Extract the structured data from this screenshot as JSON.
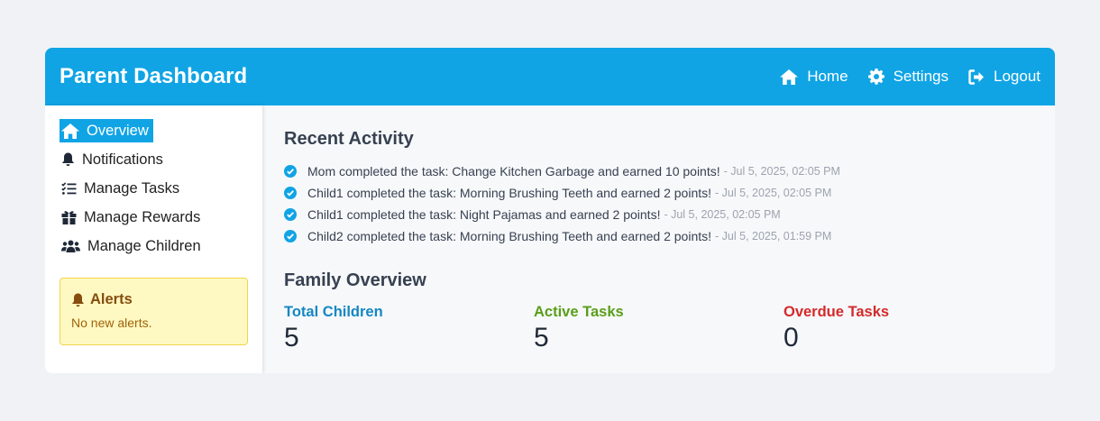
{
  "header": {
    "title": "Parent Dashboard",
    "nav": [
      {
        "label": "Home",
        "icon": "home-icon"
      },
      {
        "label": "Settings",
        "icon": "gear-icon"
      },
      {
        "label": "Logout",
        "icon": "logout-icon"
      }
    ]
  },
  "sidebar": {
    "items": [
      {
        "label": "Overview",
        "icon": "home-icon",
        "active": true
      },
      {
        "label": "Notifications",
        "icon": "bell-icon"
      },
      {
        "label": "Manage Tasks",
        "icon": "checklist-icon"
      },
      {
        "label": "Manage Rewards",
        "icon": "gift-icon"
      },
      {
        "label": "Manage Children",
        "icon": "users-icon"
      }
    ],
    "alerts": {
      "title": "Alerts",
      "text": "No new alerts."
    }
  },
  "recent_activity": {
    "title": "Recent Activity",
    "items": [
      {
        "text": "Mom completed the task: Change Kitchen Garbage and earned 10 points!",
        "time": "- Jul 5, 2025, 02:05 PM"
      },
      {
        "text": "Child1 completed the task: Morning Brushing Teeth and earned 2 points!",
        "time": "- Jul 5, 2025, 02:05 PM"
      },
      {
        "text": "Child1 completed the task: Night Pajamas and earned 2 points!",
        "time": "- Jul 5, 2025, 02:05 PM"
      },
      {
        "text": "Child2 completed the task: Morning Brushing Teeth and earned 2 points!",
        "time": "- Jul 5, 2025, 01:59 PM"
      }
    ]
  },
  "family_overview": {
    "title": "Family Overview",
    "stats": [
      {
        "label": "Total Children",
        "value": "5",
        "color": "#1487c4"
      },
      {
        "label": "Active Tasks",
        "value": "5",
        "color": "#5a9e1a"
      },
      {
        "label": "Overdue Tasks",
        "value": "0",
        "color": "#d42a2a"
      }
    ]
  },
  "colors": {
    "brand": "#10a4e5",
    "page_bg": "#f0f2f6",
    "alert_bg": "#fef9c3",
    "alert_text": "#854d0e"
  }
}
